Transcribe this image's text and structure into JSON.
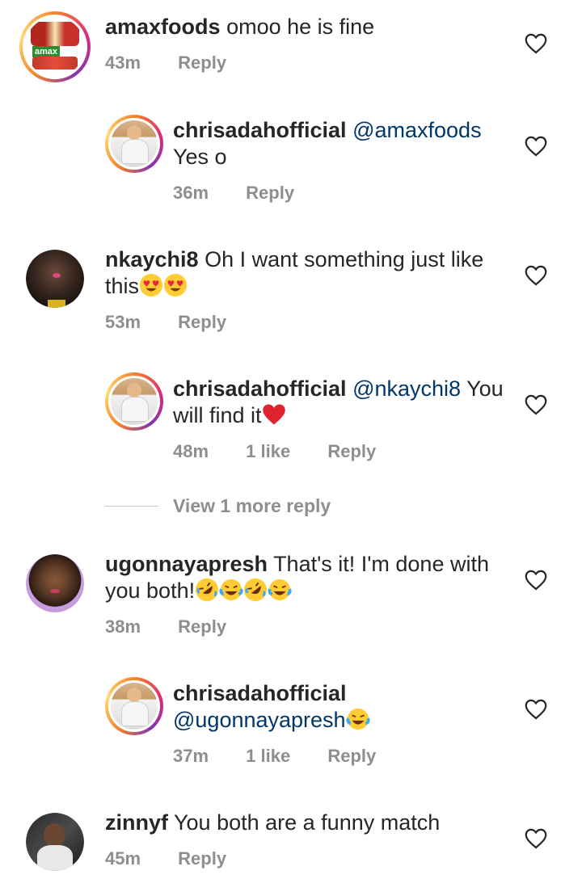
{
  "comments": [
    {
      "user": "amaxfoods",
      "text": "omoo he is fine",
      "time": "43m",
      "reply": "Reply"
    },
    {
      "user": "chrisadahofficial",
      "mention": "@amaxfoods",
      "text": "Yes o",
      "time": "36m",
      "reply": "Reply"
    },
    {
      "user": "nkaychi8",
      "text": "Oh I want something just like this",
      "time": "53m",
      "reply": "Reply"
    },
    {
      "user": "chrisadahofficial",
      "mention": "@nkaychi8",
      "text_a": "You",
      "text_b": "will find it",
      "time": "48m",
      "likes": "1 like",
      "reply": "Reply"
    },
    {
      "user": "ugonnayapresh",
      "text_a": "That's it! I'm done with",
      "text_b": "you both!",
      "time": "38m",
      "reply": "Reply"
    },
    {
      "user": "chrisadahofficial",
      "mention": "@ugonnayapresh",
      "time": "37m",
      "likes": "1 like",
      "reply": "Reply"
    },
    {
      "user": "zinnyf",
      "text": "You both are a funny match",
      "time": "45m",
      "reply": "Reply"
    }
  ],
  "view_more": "View 1 more reply",
  "icons": {
    "like": "heart-outline-icon",
    "heart_eyes": "heart-eyes-emoji",
    "red_heart": "red-heart-emoji",
    "rofl": "rolling-laughing-emoji",
    "joy": "tears-of-joy-emoji"
  },
  "colors": {
    "mention": "#00376b",
    "meta": "#8e8e8e",
    "text": "#262626"
  },
  "avatar_logo_text": "amax"
}
